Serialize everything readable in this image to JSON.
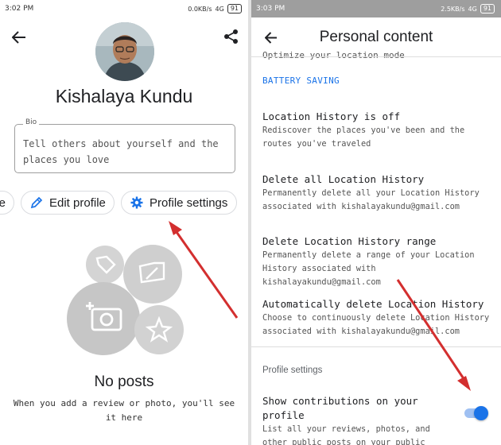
{
  "left_screen": {
    "status_bar": {
      "time": "3:02 PM",
      "speed": "0.0KB/s",
      "network": "4G",
      "battery": "91"
    },
    "profile": {
      "name": "Kishalaya Kundu"
    },
    "bio": {
      "label": "Bio",
      "placeholder": "Tell others about yourself and the places you love"
    },
    "chips": {
      "partial_label": "e",
      "edit_profile": "Edit profile",
      "profile_settings": "Profile settings"
    },
    "empty_state": {
      "title": "No posts",
      "description": "When you add a review or photo, you'll see it here"
    },
    "icons": [
      "back-arrow-icon",
      "share-icon",
      "pencil-icon",
      "gear-icon",
      "tag-icon",
      "edit-photo-icon",
      "add-photo-icon",
      "star-icon"
    ]
  },
  "right_screen": {
    "status_bar": {
      "time": "3:03 PM",
      "speed": "2.5KB/s",
      "network": "4G",
      "battery": "91"
    },
    "title": "Personal content",
    "top_partial": "Optimize your location mode",
    "battery_saving": "BATTERY SAVING",
    "items": [
      {
        "title": "Location History is off",
        "desc": "Rediscover the places you've been and the routes you've traveled"
      },
      {
        "title": "Delete all Location History",
        "desc": "Permanently delete all your Location History associated with kishalayakundu@gmail.com"
      },
      {
        "title": "Delete Location History range",
        "desc": "Permanently delete a range of your Location History associated with kishalayakundu@gmail.com"
      },
      {
        "title": "Automatically delete Location History",
        "desc": "Choose to continuously delete Location History associated with kishalayakundu@gmail.com"
      }
    ],
    "section_header": "Profile settings",
    "toggle_item": {
      "title": "Show contributions on your profile",
      "desc": "List all your reviews, photos, and other public posts on your public profile",
      "enabled": true
    }
  },
  "colors": {
    "accent": "#1a73e8",
    "annotation_arrow": "#d32f2f",
    "placeholder_gray": "#c9c9c9"
  }
}
